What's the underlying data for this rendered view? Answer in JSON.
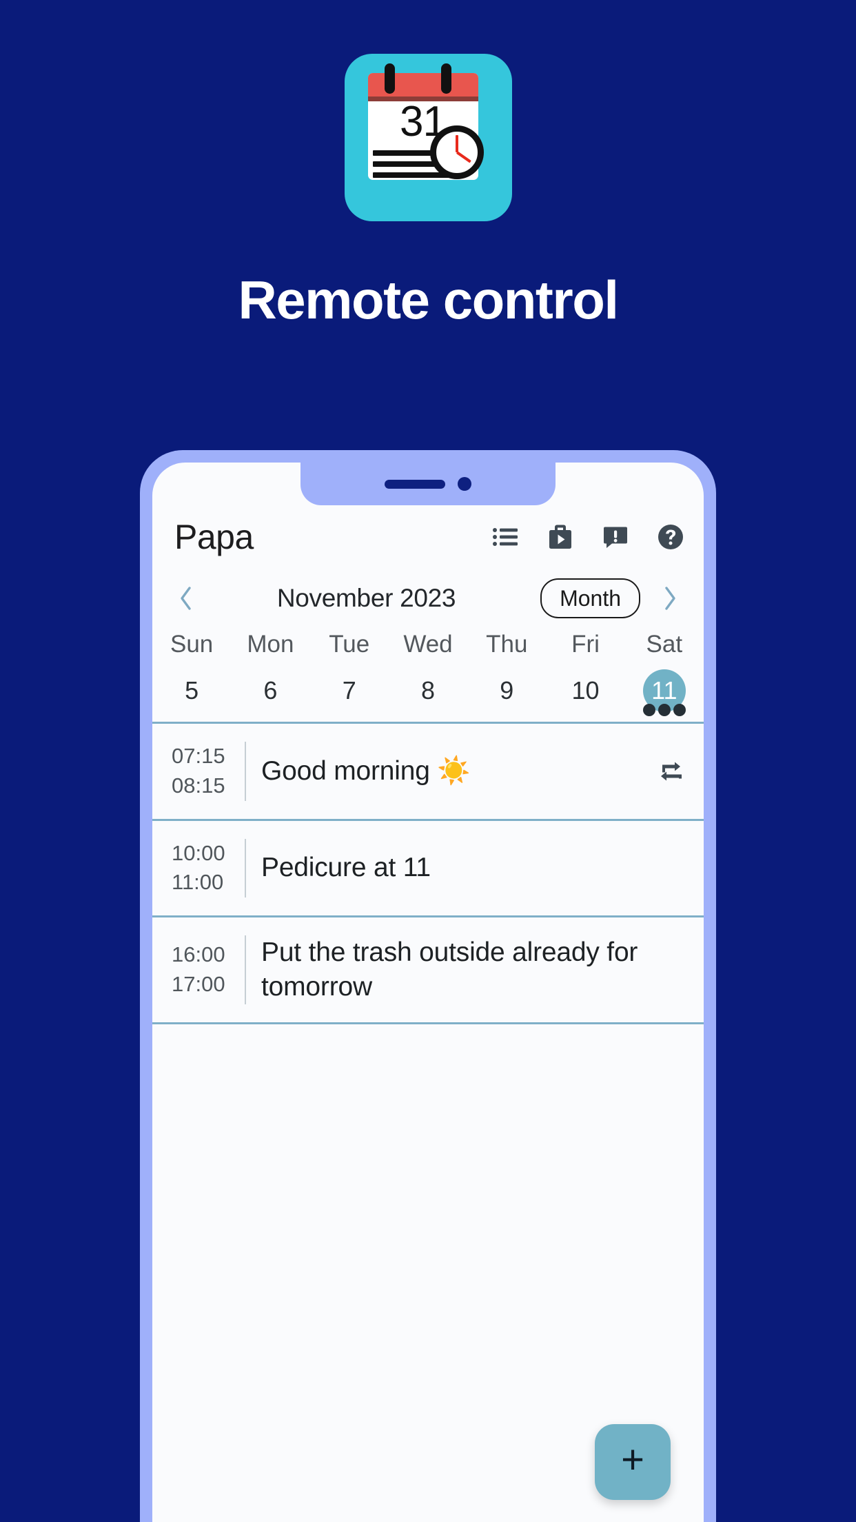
{
  "theme": {
    "background": "#0A1B7A",
    "phone_frame": "#9FB0FA",
    "screen": "#FAFBFD",
    "accent_teal": "#71B2C6",
    "icon_bg": "#35C6DC",
    "separator": "#7FAFC8"
  },
  "hero": {
    "headline": "Remote control",
    "app_icon": {
      "name": "calendar-clock-app-icon",
      "day_number": "31"
    }
  },
  "phone": {
    "app_bar": {
      "title": "Papa",
      "actions": [
        {
          "name": "list-view-icon",
          "label": "List view"
        },
        {
          "name": "media-play-icon",
          "label": "Media"
        },
        {
          "name": "message-alert-icon",
          "label": "Messages"
        },
        {
          "name": "help-circle-icon",
          "label": "Help"
        }
      ]
    },
    "month_nav": {
      "prev_label": "‹",
      "month_label": "November 2023",
      "view_toggle_label": "Month",
      "next_label": "›"
    },
    "week_strip": {
      "weekdays": [
        "Sun",
        "Mon",
        "Tue",
        "Wed",
        "Thu",
        "Fri",
        "Sat"
      ],
      "dates": [
        "5",
        "6",
        "7",
        "8",
        "9",
        "10",
        "11"
      ],
      "selected_index": 6,
      "selected_date": "11",
      "event_dot_count": 3
    },
    "events": [
      {
        "start_time": "07:15",
        "end_time": "08:15",
        "title": "Good morning ☀️",
        "recurring": true,
        "recurring_icon": "repeat-icon"
      },
      {
        "start_time": "10:00",
        "end_time": "11:00",
        "title": "Pedicure at 11",
        "recurring": false
      },
      {
        "start_time": "16:00",
        "end_time": "17:00",
        "title": "Put the trash outside already for tomorrow",
        "recurring": false
      }
    ],
    "fab": {
      "label": "+",
      "name": "add-event-button"
    }
  }
}
